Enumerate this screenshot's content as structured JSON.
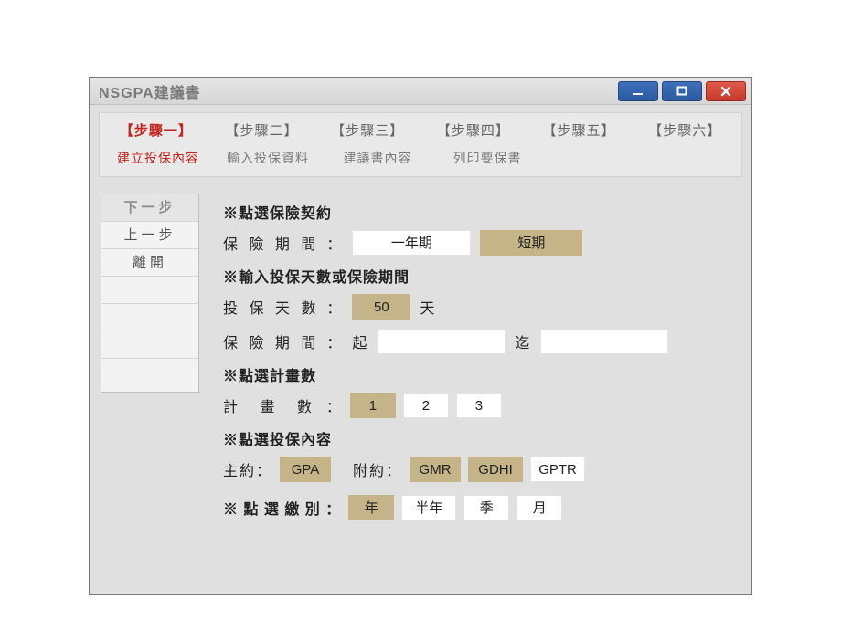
{
  "window": {
    "title": "NSGPA建議書"
  },
  "steps": {
    "items": [
      {
        "label": "【步驟一】",
        "active": true
      },
      {
        "label": "【步驟二】"
      },
      {
        "label": "【步驟三】"
      },
      {
        "label": "【步驟四】"
      },
      {
        "label": "【步驟五】"
      },
      {
        "label": "【步驟六】"
      }
    ],
    "subtabs": [
      {
        "label": "建立投保內容",
        "active": true
      },
      {
        "label": "輸入投保資料"
      },
      {
        "label": "建議書內容"
      },
      {
        "label": "列印要保書"
      }
    ]
  },
  "nav": {
    "next": "下一步",
    "prev": "上一步",
    "exit": "離開"
  },
  "form": {
    "section_contract": "※點選保險契約",
    "period_label": "保 險 期 間",
    "period_options": {
      "one_year": "一年期",
      "short_term": "短期",
      "selected": "short_term"
    },
    "section_days": "※輸入投保天數或保險期間",
    "days_label": "投 保 天 數",
    "days_value": "50",
    "days_unit": "天",
    "range_label": "保 險 期 間",
    "range_from_label": "起",
    "range_from_value": "",
    "range_to_label": "迄",
    "range_to_value": "",
    "section_plans": "※點選計畫數",
    "plans_label": "計 畫 數",
    "plans": {
      "options": [
        "1",
        "2",
        "3"
      ],
      "selected": "1"
    },
    "section_content": "※點選投保內容",
    "main_label": "主約：",
    "main_options": {
      "items": [
        "GPA"
      ],
      "selected": "GPA"
    },
    "rider_label": "附約：",
    "rider_options": {
      "items": [
        "GMR",
        "GDHI",
        "GPTR"
      ],
      "selected": [
        "GMR",
        "GDHI"
      ]
    },
    "section_mode": "※ 點 選 繳 別 ：",
    "mode_options": {
      "items": [
        "年",
        "半年",
        "季",
        "月"
      ],
      "selected": "年"
    }
  }
}
